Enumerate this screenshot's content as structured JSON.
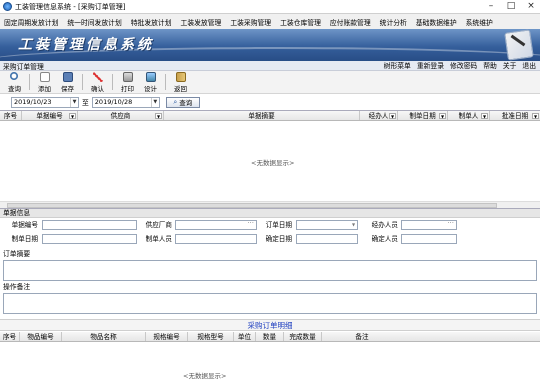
{
  "window": {
    "title": "工装管理信息系统 - [采购订单管理]",
    "controls": [
      "–",
      "□",
      "×"
    ]
  },
  "menu": [
    "固定周期发放计划",
    "统一时间发放计划",
    "特批发放计划",
    "工装发放管理",
    "工装采购管理",
    "工装仓库管理",
    "应付账款管理",
    "统计分析",
    "基础数据维护",
    "系统维护"
  ],
  "banner": {
    "title": "工装管理信息系统"
  },
  "module": "采购订单管理",
  "header_links": [
    "树形菜单",
    "重新登录",
    "修改密码",
    "帮助",
    "关于",
    "退出"
  ],
  "toolbar": [
    {
      "label": "查询",
      "icon": "search-icon"
    },
    {
      "label": "添加",
      "icon": "add-icon"
    },
    {
      "label": "保存",
      "icon": "save-icon"
    },
    {
      "label": "确认",
      "icon": "confirm-icon"
    },
    {
      "label": "打印",
      "icon": "print-icon"
    },
    {
      "label": "设计",
      "icon": "design-icon"
    },
    {
      "label": "返回",
      "icon": "back-icon"
    }
  ],
  "filter": {
    "start": "2019/10/23",
    "to": "至",
    "end": "2019/10/28",
    "query": "查询"
  },
  "order_grid": {
    "columns": [
      "序号",
      "单据编号",
      "供应商",
      "单据摘要",
      "经办人",
      "制单日期",
      "制单人",
      "批准日期"
    ],
    "empty": "<无数据显示>"
  },
  "form": {
    "section": "单据信息",
    "labels": {
      "doc_no": "单据编号",
      "supplier": "供应厂商",
      "order_date": "订单日期",
      "handler": "经办人员",
      "make_date": "制单日期",
      "maker": "制单人员",
      "confirm_date": "确定日期",
      "confirmer": "确定人员"
    },
    "summary_label": "订单摘要",
    "remark_label": "操作备注"
  },
  "detail": {
    "title": "采购订单明细",
    "columns": [
      "序号",
      "物品编号",
      "物品名称",
      "规格编号",
      "规格型号",
      "单位",
      "数量",
      "完成数量",
      "备注"
    ],
    "empty": "<无数据显示>"
  },
  "colors": {
    "banner": "#355f9c",
    "detail_title": "#2040c0"
  }
}
